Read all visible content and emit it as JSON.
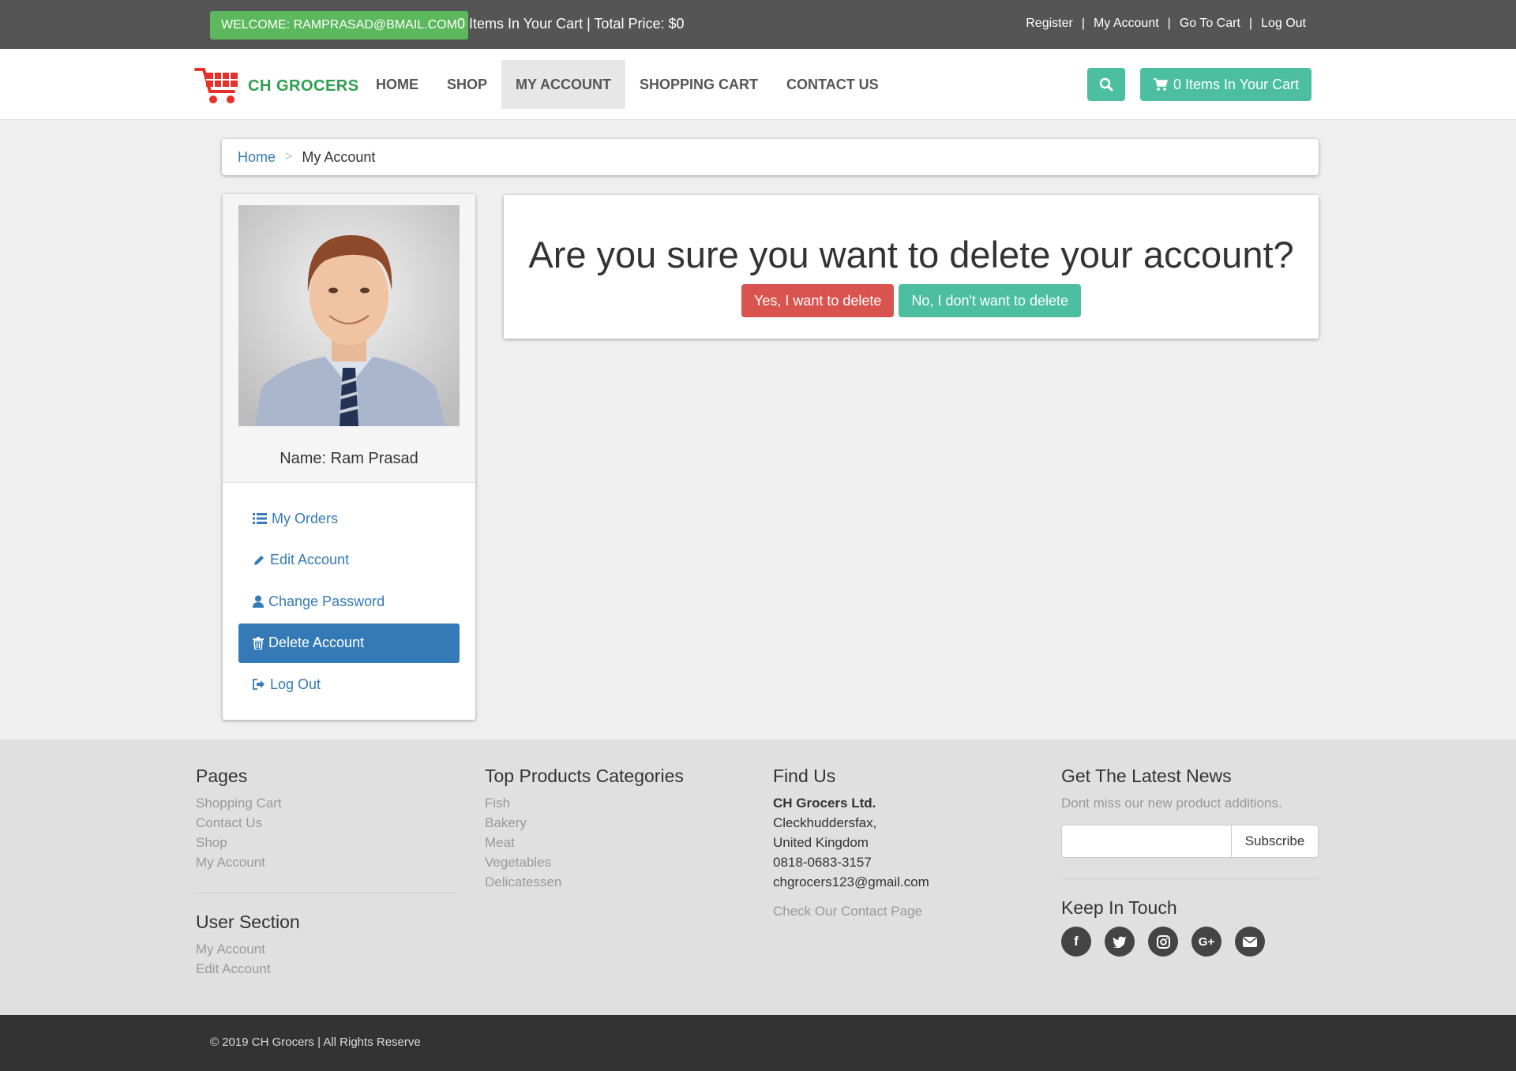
{
  "topbar": {
    "welcome": "WELCOME: RAMPRASAD@BMAIL.COM",
    "cart_summary": "0 Items In Your Cart | Total Price: $0",
    "links": [
      "Register",
      "My Account",
      "Go To Cart",
      "Log Out"
    ]
  },
  "navbar": {
    "brand": "CH GROCERS",
    "items": [
      "HOME",
      "SHOP",
      "MY ACCOUNT",
      "SHOPPING CART",
      "CONTACT US"
    ],
    "active": "MY ACCOUNT",
    "cart_button": "0 Items In Your Cart",
    "accent": "#4cbfa0"
  },
  "breadcrumb": {
    "home": "Home",
    "separator": ">",
    "current": "My Account"
  },
  "profile": {
    "name": "Name: Ram Prasad"
  },
  "sidebar_menu": [
    {
      "label": "My Orders",
      "icon": "list-icon"
    },
    {
      "label": "Edit Account",
      "icon": "pencil-icon"
    },
    {
      "label": "Change Password",
      "icon": "user-icon"
    },
    {
      "label": "Delete Account",
      "icon": "trash-icon"
    },
    {
      "label": "Log Out",
      "icon": "sign-out-icon"
    }
  ],
  "confirm": {
    "question": "Are you sure you want to delete your account?",
    "yes": "Yes, I want to delete",
    "no": "No, I don't want to delete",
    "yes_color": "#d9534f",
    "no_color": "#4cbfa0"
  },
  "footer": {
    "pages": {
      "title": "Pages",
      "links": [
        "Shopping Cart",
        "Contact Us",
        "Shop",
        "My Account"
      ]
    },
    "user_section": {
      "title": "User Section",
      "links": [
        "My Account",
        "Edit Account"
      ]
    },
    "categories": {
      "title": "Top Products Categories",
      "links": [
        "Fish",
        "Bakery",
        "Meat",
        "Vegetables",
        "Delicatessen"
      ]
    },
    "find_us": {
      "title": "Find Us",
      "company": "CH Grocers Ltd.",
      "lines": [
        "Cleckhuddersfax,",
        "United Kingdom",
        "0818-0683-3157",
        "chgrocers123@gmail.com"
      ],
      "contact_link": "Check Our Contact Page"
    },
    "news": {
      "title": "Get The Latest News",
      "text": "Dont miss our new product additions.",
      "subscribe": "Subscribe",
      "keep_title": "Keep In Touch",
      "social_icons": [
        "facebook-icon",
        "twitter-icon",
        "instagram-icon",
        "google-plus-icon",
        "envelope-icon"
      ]
    },
    "copyright": "© 2019 CH Grocers | All Rights Reserve"
  }
}
